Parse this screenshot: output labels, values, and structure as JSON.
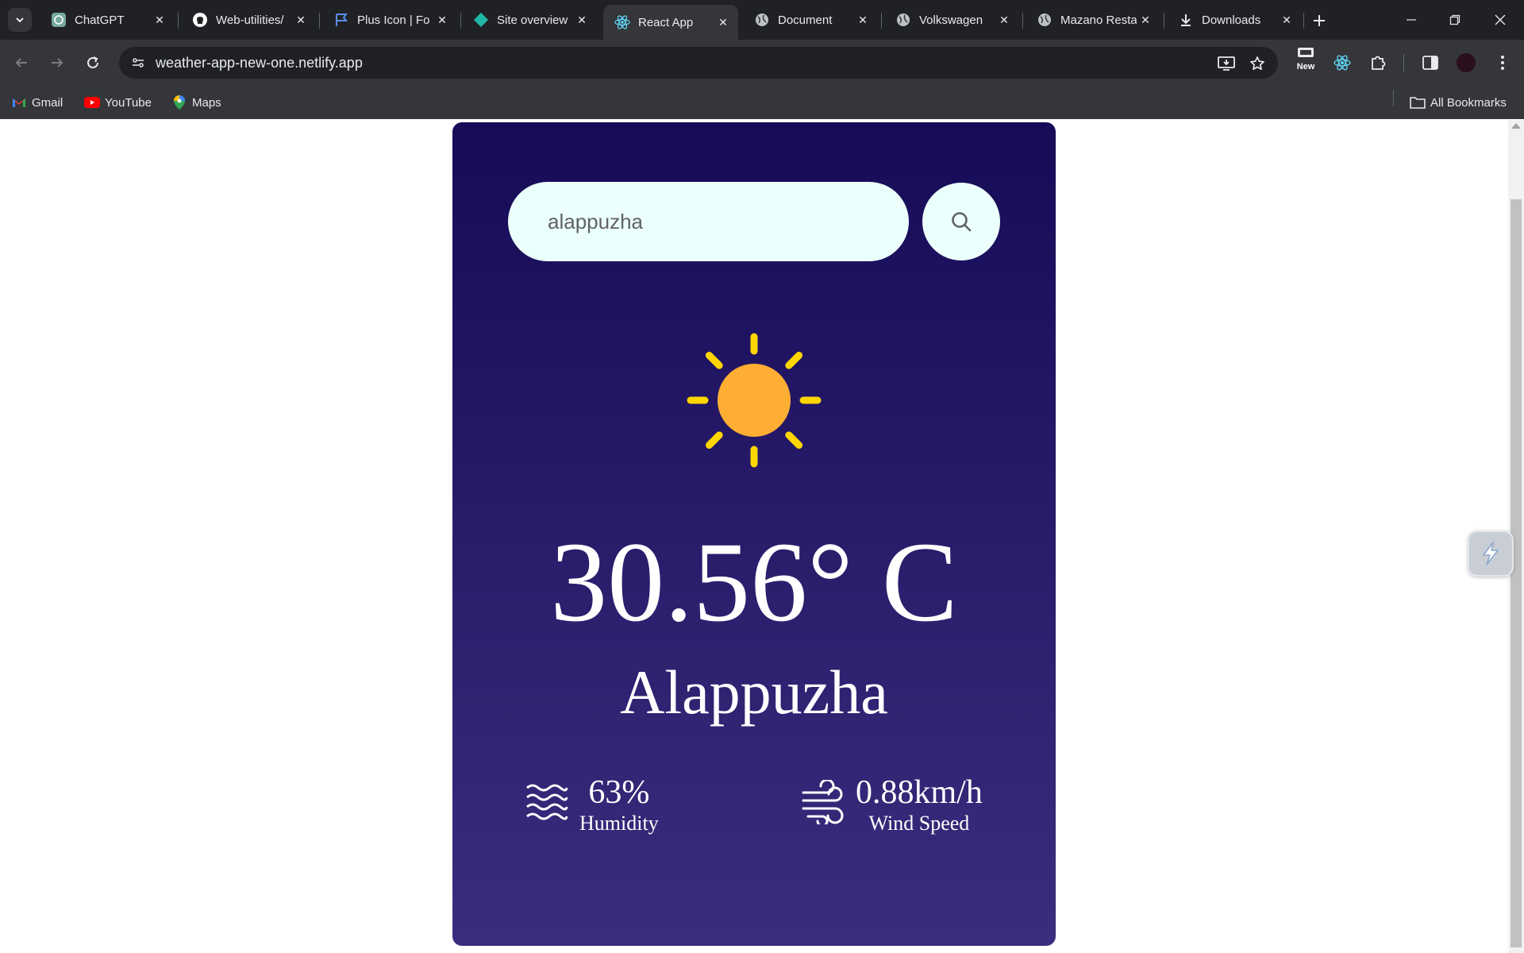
{
  "browser": {
    "tabs": [
      {
        "title": "ChatGPT",
        "active": false
      },
      {
        "title": "Web-utilities/",
        "active": false
      },
      {
        "title": "Plus Icon | Fo",
        "active": false
      },
      {
        "title": "Site overview",
        "active": false
      },
      {
        "title": "React App",
        "active": true
      },
      {
        "title": "Document",
        "active": false
      },
      {
        "title": "Volkswagen",
        "active": false
      },
      {
        "title": "Mazano Resta",
        "active": false
      },
      {
        "title": "Downloads",
        "active": false
      }
    ],
    "url": "weather-app-new-one.netlify.app",
    "new_badge": "New",
    "bookmarks": [
      {
        "label": "Gmail"
      },
      {
        "label": "YouTube"
      },
      {
        "label": "Maps"
      }
    ],
    "all_bookmarks": "All Bookmarks"
  },
  "app": {
    "search": {
      "value": "alappuzha",
      "placeholder": "search"
    },
    "temperature": "30.56° C",
    "city": "Alappuzha",
    "humidity": {
      "value": "63%",
      "label": "Humidity"
    },
    "wind": {
      "value": "0.88km/h",
      "label": "Wind Speed"
    },
    "card_gradient": [
      "#160b57",
      "#3a2d7e"
    ],
    "sun_color": "#ffae34",
    "ray_color": "#ffd600"
  }
}
